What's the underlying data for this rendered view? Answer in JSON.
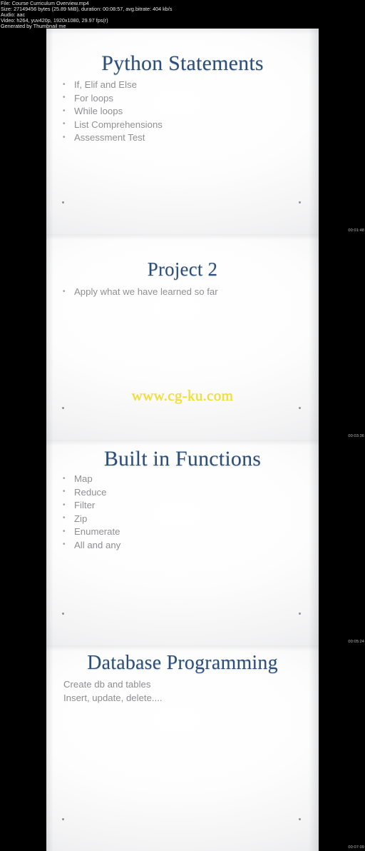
{
  "metadata": {
    "lines": [
      "File: Course Curriculum Overview.mp4",
      "Size: 27149456 bytes (25.89 MiB), duration: 00:08:57, avg.bitrate: 404 kb/s",
      "Audio: aac",
      "Video: h264, yuv420p, 1920x1080, 29.97 fps(r)",
      "Generated by Thumbnail me"
    ]
  },
  "watermark": {
    "text": "www.cg-ku.com",
    "color": "#f5e11e"
  },
  "theme": {
    "title_color": "#2b4f79",
    "body_color": "#909093",
    "background": "#000000",
    "slide_background": "#ffffff"
  },
  "slides": [
    {
      "title": "Python Statements",
      "bullets": [
        "If, Elif and Else",
        "For loops",
        "While loops",
        "List Comprehensions",
        "Assessment Test"
      ],
      "lines": [],
      "timestamp": "00:01:48"
    },
    {
      "title": "Project 2",
      "bullets": [
        "Apply what we have learned so far"
      ],
      "lines": [],
      "timestamp": "00:03:36"
    },
    {
      "title": "Built in Functions",
      "bullets": [
        "Map",
        "Reduce",
        "Filter",
        "Zip",
        "Enumerate",
        "All and any"
      ],
      "lines": [],
      "timestamp": "00:05:24"
    },
    {
      "title": "Database Programming",
      "bullets": [],
      "lines": [
        "Create db and tables",
        "Insert, update, delete...."
      ],
      "timestamp": "00:07:09"
    }
  ]
}
